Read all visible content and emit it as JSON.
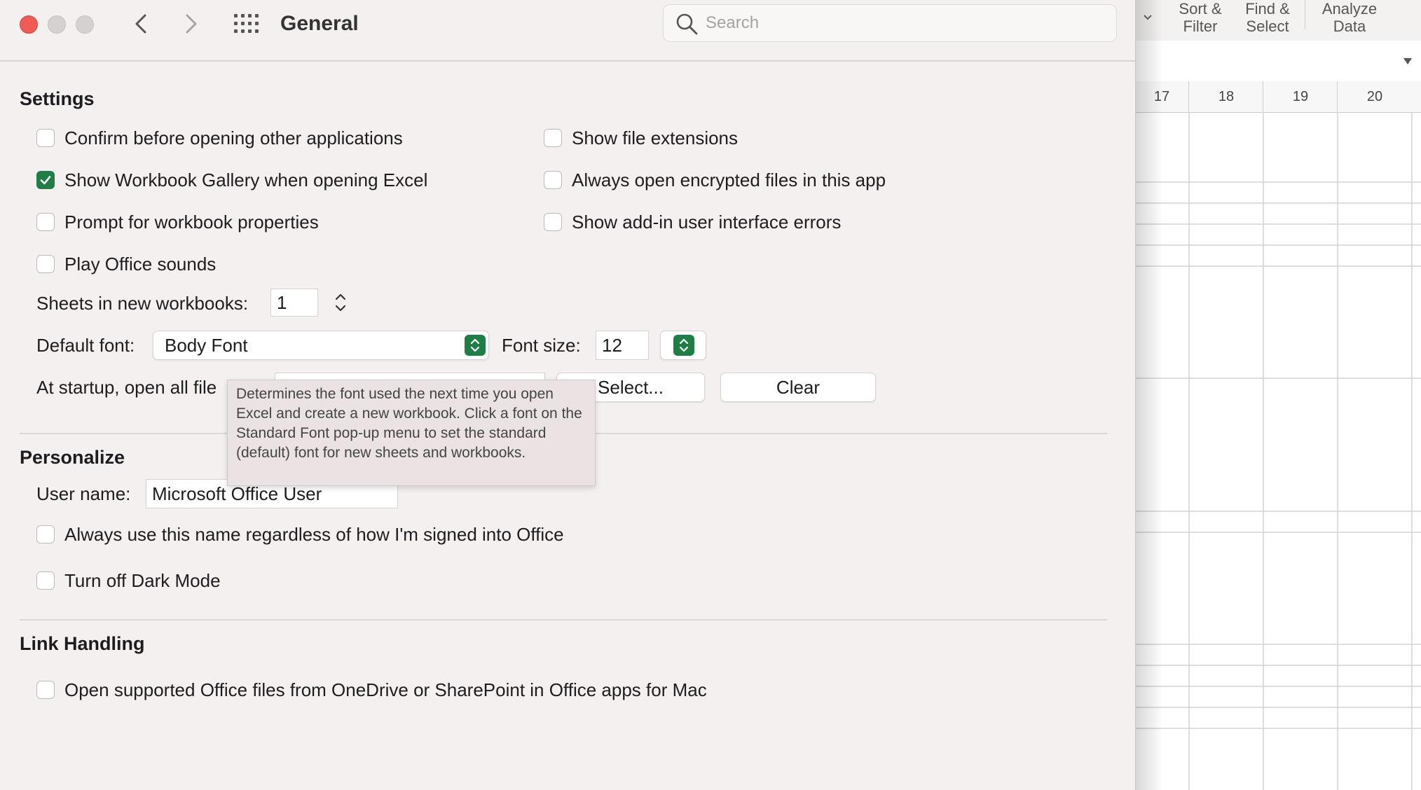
{
  "window": {
    "title": "General",
    "search_placeholder": "Search"
  },
  "settings": {
    "title": "Settings",
    "left_checkboxes": [
      {
        "label": "Confirm before opening other applications",
        "checked": false
      },
      {
        "label": "Show Workbook Gallery when opening Excel",
        "checked": true
      },
      {
        "label": "Prompt for workbook properties",
        "checked": false
      },
      {
        "label": "Play Office sounds",
        "checked": false
      }
    ],
    "right_checkboxes": [
      {
        "label": "Show file extensions",
        "checked": false
      },
      {
        "label": "Always open encrypted files in this app",
        "checked": false
      },
      {
        "label": "Show add-in user interface errors",
        "checked": false
      }
    ],
    "sheets_label": "Sheets in new workbooks:",
    "sheets_value": "1",
    "default_font_label": "Default font:",
    "default_font_value": "Body Font",
    "font_size_label": "Font size:",
    "font_size_value": "12",
    "startup_label": "At startup, open all file",
    "select_button": "Select...",
    "clear_button": "Clear"
  },
  "tooltip": {
    "text": "Determines the font used the next time you open Excel and create a new workbook. Click a font on the Standard Font pop-up menu to set the standard (default) font for new sheets and workbooks."
  },
  "personalize": {
    "title": "Personalize",
    "user_name_label": "User name:",
    "user_name_value": "Microsoft Office User",
    "checkboxes": [
      {
        "label": "Always use this name regardless of how I'm signed into Office",
        "checked": false
      },
      {
        "label": "Turn off Dark Mode",
        "checked": false
      }
    ]
  },
  "link_handling": {
    "title": "Link Handling",
    "checkboxes": [
      {
        "label": "Open supported Office files from OneDrive or SharePoint in Office apps for Mac",
        "checked": false
      }
    ]
  },
  "spreadsheet": {
    "ribbon": [
      {
        "line1": "Sort &",
        "line2": "Filter"
      },
      {
        "line1": "Find &",
        "line2": "Select"
      },
      {
        "line1": "Analyze",
        "line2": "Data"
      }
    ],
    "column_headers": [
      "17",
      "18",
      "19",
      "20"
    ]
  },
  "colors": {
    "accent": "#1e7e45",
    "close": "#ee5c55",
    "window_bg": "#f5f0f0"
  }
}
